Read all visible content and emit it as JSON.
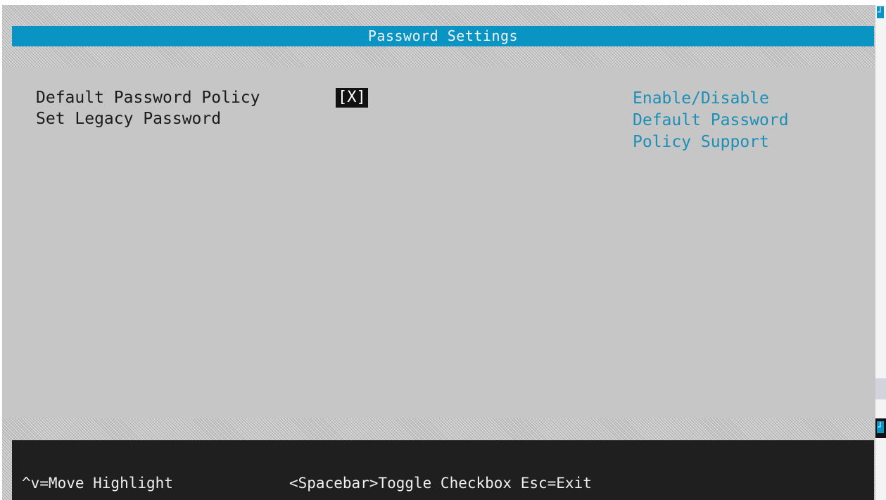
{
  "window": {
    "title": "Password Settings"
  },
  "menu": {
    "items": [
      {
        "label": "Default Password Policy"
      },
      {
        "label": "Set Legacy Password"
      }
    ],
    "checkbox_value": "[X]"
  },
  "help": {
    "lines": [
      "Enable/Disable",
      "Default Password",
      "Policy Support"
    ]
  },
  "status": {
    "move": "^v=Move Highlight",
    "toggle": "<Spacebar>Toggle Checkbox Esc=Exit"
  },
  "icons": {
    "corner": "corner-mark-icon"
  },
  "colors": {
    "title_bar": "#0a94c3",
    "panel": "#c6c6c6",
    "help_text": "#1b8fb6",
    "status_bar": "#1f1f1f"
  }
}
